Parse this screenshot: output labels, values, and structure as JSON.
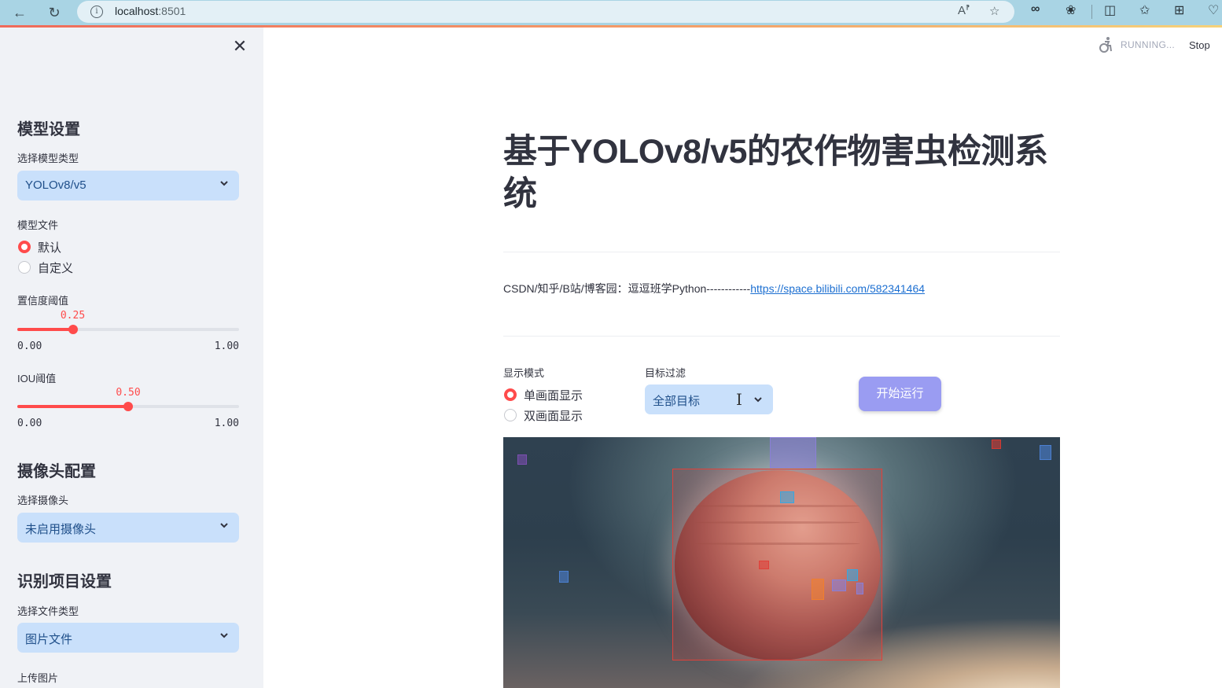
{
  "browser": {
    "url_host": "localhost",
    "url_port": ":8501",
    "icons": [
      "back-icon",
      "reload-icon",
      "info-icon",
      "read-aloud-icon",
      "favorite-star-icon",
      "infinity-icon",
      "extensions-icon",
      "split-screen-icon",
      "favorites-list-icon",
      "collections-icon",
      "health-icon"
    ]
  },
  "app_status": {
    "state": "RUNNING...",
    "stop_label": "Stop"
  },
  "sidebar": {
    "close_label": "✕",
    "model_section": {
      "heading": "模型设置",
      "model_type_label": "选择模型类型",
      "model_type_value": "YOLOv8/v5",
      "model_file_label": "模型文件",
      "model_file_options": [
        {
          "label": "默认",
          "selected": true
        },
        {
          "label": "自定义",
          "selected": false
        }
      ],
      "confidence": {
        "label": "置信度阈值",
        "value": 0.25,
        "display": "0.25",
        "min": "0.00",
        "max": "1.00"
      },
      "iou": {
        "label": "IOU阈值",
        "value": 0.5,
        "display": "0.50",
        "min": "0.00",
        "max": "1.00"
      }
    },
    "camera_section": {
      "heading": "摄像头配置",
      "camera_label": "选择摄像头",
      "camera_value": "未启用摄像头"
    },
    "detect_section": {
      "heading": "识别项目设置",
      "file_type_label": "选择文件类型",
      "file_type_value": "图片文件",
      "upload_label": "上传图片"
    }
  },
  "main": {
    "title": "基于YOLOv8/v5的农作物害虫检测系统",
    "info_prefix": "CSDN/知乎/B站/博客园：逗逗班学Python------------",
    "info_link": "https://space.bilibili.com/582341464",
    "display_mode": {
      "label": "显示模式",
      "options": [
        {
          "label": "单画面显示",
          "selected": true
        },
        {
          "label": "双画面显示",
          "selected": false
        }
      ]
    },
    "target_filter": {
      "label": "目标过滤",
      "value": "全部目标"
    },
    "run_button": "开始运行",
    "detections": [
      {
        "color": "#e0413a",
        "kind": "large"
      },
      {
        "color": "#8a7fd6",
        "kind": "small"
      },
      {
        "color": "#7b4fb0",
        "kind": "small"
      },
      {
        "color": "#d23a32",
        "kind": "small"
      },
      {
        "color": "#4b7fd0",
        "kind": "small"
      },
      {
        "color": "#3aa6de",
        "kind": "small"
      },
      {
        "color": "#4b7fd0",
        "kind": "small"
      },
      {
        "color": "#e0413a",
        "kind": "small"
      },
      {
        "color": "#f07e2e",
        "kind": "small"
      },
      {
        "color": "#8a7fd6",
        "kind": "small"
      },
      {
        "color": "#3aa6de",
        "kind": "small"
      },
      {
        "color": "#8a7fd6",
        "kind": "small"
      }
    ]
  },
  "colors": {
    "accent": "#ff4b4b",
    "select_bg": "#c9e0fb",
    "select_text": "#1f4f8a",
    "sidebar_bg": "#f0f2f6",
    "run_button_bg": "#9a9cf2",
    "link": "#1c6fd1"
  }
}
